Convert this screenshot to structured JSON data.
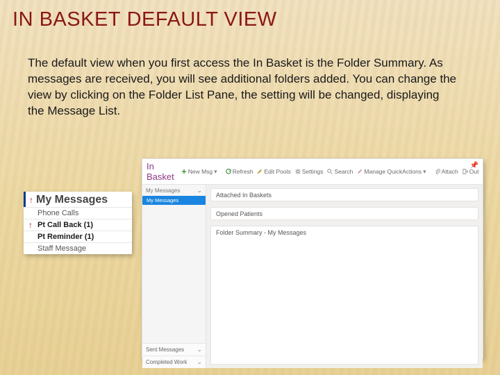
{
  "slide": {
    "title_lead": "I",
    "title_lead2": "N",
    "title_word1": "BASKET",
    "title_word2": "DEFAULT",
    "title_word3": "VIEW",
    "body": "The default view when you first access the In Basket is the Folder Summary.  As messages are received, you will see additional folders added.  You can change the view by clicking on the Folder List Pane, the setting will be changed, displaying the Message List."
  },
  "my_messages_box": {
    "header_icon": "up-arrow-red",
    "header": "My Messages",
    "rows": [
      {
        "label": "Phone Calls",
        "bold": false,
        "arrow": false
      },
      {
        "label": "Pt Call Back (1)",
        "bold": true,
        "arrow": true
      },
      {
        "label": "Pt Reminder (1)",
        "bold": true,
        "arrow": false
      },
      {
        "label": "Staff Message",
        "bold": false,
        "arrow": false
      }
    ]
  },
  "inbasket": {
    "title": "In Basket",
    "toolbar": [
      {
        "id": "new-msg",
        "label": "New Msg",
        "icon": "plus",
        "dropdown": true
      },
      {
        "id": "refresh",
        "label": "Refresh",
        "icon": "refresh"
      },
      {
        "id": "edit-pools",
        "label": "Edit Pools",
        "icon": "pencil"
      },
      {
        "id": "settings",
        "label": "Settings",
        "icon": "gear"
      },
      {
        "id": "search",
        "label": "Search",
        "icon": "search"
      },
      {
        "id": "manage-quickactions",
        "label": "Manage QuickActions",
        "icon": "wand",
        "dropdown": true
      },
      {
        "id": "attach",
        "label": "Attach",
        "icon": "paperclip"
      },
      {
        "id": "out",
        "label": "Out",
        "icon": "out"
      }
    ],
    "pin_icon": "pin",
    "folder_pane": {
      "header": "My Messages",
      "header_icon": "chevron-down",
      "selected": "My Messages",
      "bottom": [
        {
          "label": "Sent Messages",
          "icon": "chevron-down"
        },
        {
          "label": "Completed Work",
          "icon": "chevron-down"
        }
      ]
    },
    "content_cards": [
      "Attached In Baskets",
      "Opened Patients",
      "Folder Summary - My Messages"
    ]
  }
}
